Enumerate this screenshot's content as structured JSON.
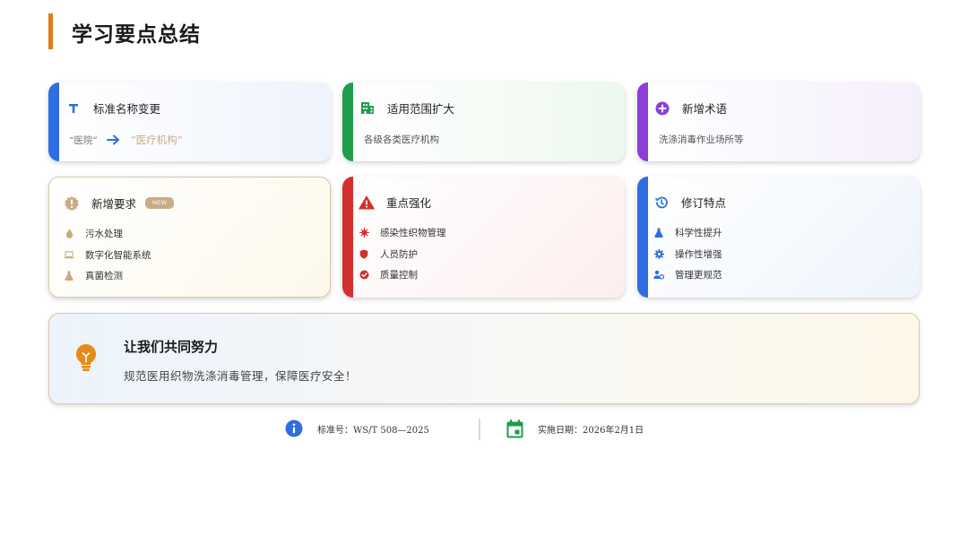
{
  "page": {
    "title": "学习要点总结"
  },
  "cards": [
    {
      "title": "标准名称变更",
      "icon": "text-t-icon",
      "accent": "#2f6ee0",
      "from": "“医院”",
      "to": "“医疗机构”"
    },
    {
      "title": "适用范围扩大",
      "icon": "building-icon",
      "accent": "#1f9d4c",
      "text": "各级各类医疗机构"
    },
    {
      "title": "新增术语",
      "icon": "plus-circle-icon",
      "accent": "#8a3fd6",
      "text": "洗涤消毒作业场所等"
    },
    {
      "title": "新增要求",
      "icon": "exclamation-icon",
      "accent": "#c9ac84",
      "badge": "NEW",
      "items": [
        {
          "text": "污水处理",
          "icon": "droplet-icon"
        },
        {
          "text": "数字化智能系统",
          "icon": "laptop-icon"
        },
        {
          "text": "真菌检测",
          "icon": "flask-icon"
        }
      ]
    },
    {
      "title": "重点强化",
      "icon": "warning-icon",
      "accent": "#d32f2f",
      "items": [
        {
          "text": "感染性织物管理",
          "icon": "virus-icon"
        },
        {
          "text": "人员防护",
          "icon": "shield-icon"
        },
        {
          "text": "质量控制",
          "icon": "check-badge-icon"
        }
      ]
    },
    {
      "title": "修订特点",
      "icon": "history-icon",
      "accent": "#2f6ee0",
      "items": [
        {
          "text": "科学性提升",
          "icon": "flask-icon"
        },
        {
          "text": "操作性增强",
          "icon": "gear-icon"
        },
        {
          "text": "管理更规范",
          "icon": "users-gear-icon"
        }
      ]
    }
  ],
  "banner": {
    "title": "让我们共同努力",
    "subtitle": "规范医用织物洗涤消毒管理，保障医疗安全！",
    "icon": "lightbulb-icon"
  },
  "footer": {
    "standard": {
      "label": "标准号：WS/T 508—2025",
      "icon": "info-icon"
    },
    "date": {
      "label": "实施日期：2026年2月1日",
      "icon": "calendar-icon"
    }
  },
  "colors": {
    "title_bar": "#e07d16",
    "blue": "#2f6ee0",
    "green": "#1f9d4c",
    "purple": "#8a3fd6",
    "red": "#d32f2f",
    "gold": "#c9ac84",
    "bulb": "#e88a1a"
  }
}
